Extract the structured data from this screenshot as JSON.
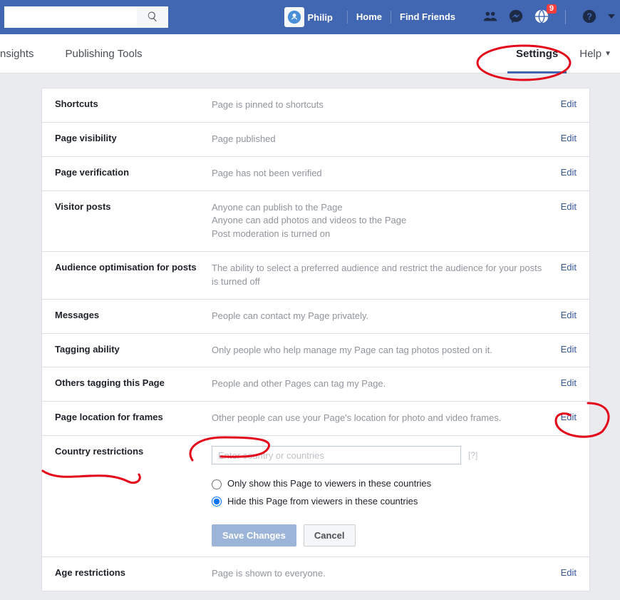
{
  "header": {
    "search_placeholder": "",
    "username": "Philip",
    "home": "Home",
    "find_friends": "Find Friends",
    "badge": "9"
  },
  "tabs": {
    "insights": "nsights",
    "publishing": "Publishing Tools",
    "settings": "Settings",
    "help": "Help"
  },
  "rows": {
    "shortcuts": {
      "label": "Shortcuts",
      "desc": "Page is pinned to shortcuts",
      "edit": "Edit"
    },
    "visibility": {
      "label": "Page visibility",
      "desc": "Page published",
      "edit": "Edit"
    },
    "verification": {
      "label": "Page verification",
      "desc": "Page has not been verified",
      "edit": "Edit"
    },
    "visitor_posts": {
      "label": "Visitor posts",
      "desc1": "Anyone can publish to the Page",
      "desc2": "Anyone can add photos and videos to the Page",
      "desc3": "Post moderation is turned on",
      "edit": "Edit"
    },
    "audience": {
      "label": "Audience optimisation for posts",
      "desc": "The ability to select a preferred audience and restrict the audience for your posts is turned off",
      "edit": "Edit"
    },
    "messages": {
      "label": "Messages",
      "desc": "People can contact my Page privately.",
      "edit": "Edit"
    },
    "tagging": {
      "label": "Tagging ability",
      "desc": "Only people who help manage my Page can tag photos posted on it.",
      "edit": "Edit"
    },
    "others_tagging": {
      "label": "Others tagging this Page",
      "desc": "People and other Pages can tag my Page.",
      "edit": "Edit"
    },
    "location_frames": {
      "label": "Page location for frames",
      "desc": "Other people can use your Page's location for photo and video frames.",
      "edit": "Edit"
    },
    "country": {
      "label": "Country restrictions",
      "placeholder": "Enter country or countries",
      "help": "[?]",
      "radio1": "Only show this Page to viewers in these countries",
      "radio2": "Hide this Page from viewers in these countries",
      "save": "Save Changes",
      "cancel": "Cancel"
    },
    "age": {
      "label": "Age restrictions",
      "desc": "Page is shown to everyone.",
      "edit": "Edit"
    }
  }
}
